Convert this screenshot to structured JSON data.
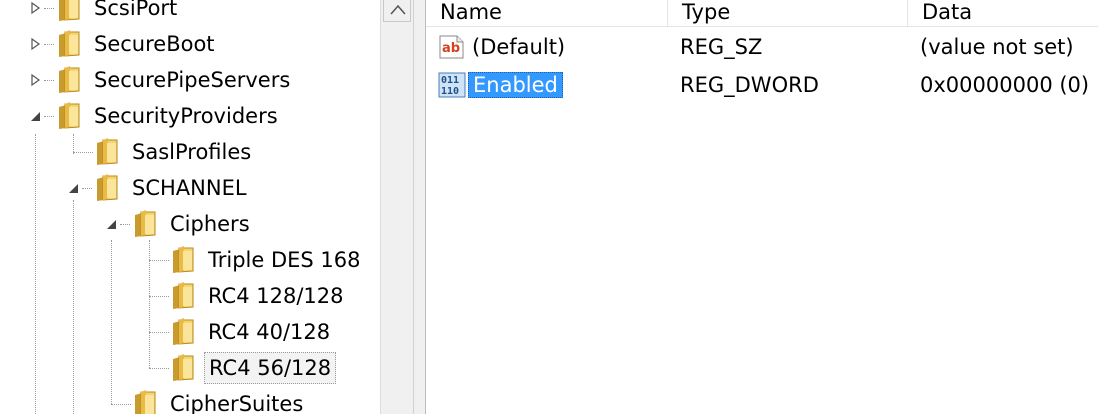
{
  "tree": {
    "items": [
      {
        "label": "ScsiPort"
      },
      {
        "label": "SecureBoot"
      },
      {
        "label": "SecurePipeServers"
      },
      {
        "label": "SecurityProviders"
      },
      {
        "label": "SaslProfiles"
      },
      {
        "label": "SCHANNEL"
      },
      {
        "label": "Ciphers"
      },
      {
        "label": "Triple DES 168"
      },
      {
        "label": "RC4 128/128"
      },
      {
        "label": "RC4 40/128"
      },
      {
        "label": "RC4 56/128"
      },
      {
        "label": "CipherSuites"
      }
    ]
  },
  "list": {
    "columns": [
      "Name",
      "Type",
      "Data"
    ],
    "rows": [
      {
        "name": "(Default)",
        "type": "REG_SZ",
        "data": "(value not set)",
        "icon": "string-value-icon"
      },
      {
        "name": "Enabled",
        "type": "REG_DWORD",
        "data": "0x00000000 (0)",
        "icon": "dword-value-icon"
      }
    ]
  },
  "colors": {
    "selection": "#3399ff",
    "folder": "#e8c252"
  }
}
